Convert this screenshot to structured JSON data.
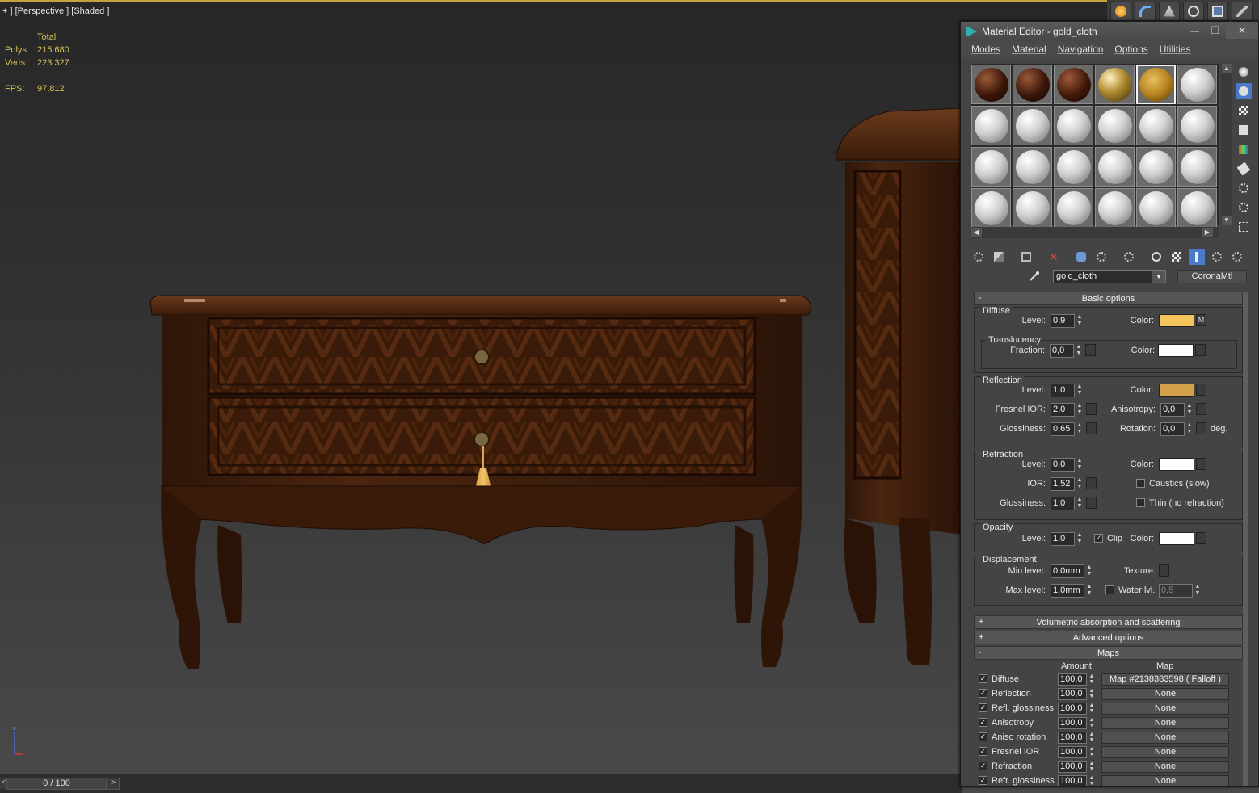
{
  "viewport": {
    "label": "+ ] [Perspective ] [Shaded ]",
    "stats": {
      "total_label": "Total",
      "polys_label": "Polys:",
      "polys_value": "215 680",
      "verts_label": "Verts:",
      "verts_value": "223 327",
      "fps_label": "FPS:",
      "fps_value": "97,812"
    },
    "stats_color": "#d9c45a"
  },
  "top_toolbar": {
    "icons": [
      "render-setup-icon",
      "render-frame-icon",
      "render-iterative-icon",
      "environment-icon",
      "render-window-icon",
      "hammer-icon"
    ]
  },
  "timeline": {
    "frame_label": "0 / 100",
    "prev": "<",
    "next": ">"
  },
  "material_editor": {
    "title": "Material Editor - gold_cloth",
    "window_buttons": {
      "minimize": "—",
      "maximize": "❐",
      "close": "✕"
    },
    "menu": [
      "Modes",
      "Material",
      "Navigation",
      "Options",
      "Utilities"
    ],
    "slots": {
      "row1": [
        "wood-dark",
        "wood-dark",
        "wood-dark",
        "gold-metal",
        "gold-cloth",
        "default"
      ],
      "active_index": 4
    },
    "name_field": "gold_cloth",
    "type_button": "CoronaMtl",
    "basic_options": {
      "header": "Basic options",
      "diffuse": {
        "title": "Diffuse",
        "level_label": "Level:",
        "level": "0,9",
        "color_label": "Color:",
        "color": "#f5c35c",
        "map_btn": "M",
        "translucency": {
          "title": "Translucency",
          "fraction_label": "Fraction:",
          "fraction": "0,0",
          "color_label": "Color:",
          "color": "#ffffff"
        }
      },
      "reflection": {
        "title": "Reflection",
        "level_label": "Level:",
        "level": "1,0",
        "color_label": "Color:",
        "color": "#d4a24a",
        "fresnel_label": "Fresnel IOR:",
        "fresnel": "2,0",
        "aniso_label": "Anisotropy:",
        "aniso": "0,0",
        "gloss_label": "Glossiness:",
        "gloss": "0,65",
        "rotation_label": "Rotation:",
        "rotation": "0,0",
        "deg": "deg."
      },
      "refraction": {
        "title": "Refraction",
        "level_label": "Level:",
        "level": "0,0",
        "color_label": "Color:",
        "color": "#ffffff",
        "ior_label": "IOR:",
        "ior": "1,52",
        "caustics": "Caustics (slow)",
        "gloss_label": "Glossiness:",
        "gloss": "1,0",
        "thin": "Thin (no refraction)"
      },
      "opacity": {
        "title": "Opacity",
        "level_label": "Level:",
        "level": "1,0",
        "clip": "Clip",
        "color_label": "Color:",
        "color": "#ffffff"
      },
      "displacement": {
        "title": "Displacement",
        "min_label": "Min level:",
        "min": "0,0mm",
        "texture_label": "Texture:",
        "max_label": "Max level:",
        "max": "1,0mm",
        "water_label": "Water lvl.",
        "water": "0,5"
      }
    },
    "rollouts": {
      "volumetric": "Volumetric absorption and scattering",
      "advanced": "Advanced options",
      "maps": "Maps"
    },
    "maps": {
      "amount_header": "Amount",
      "map_header": "Map",
      "rows": [
        {
          "name": "Diffuse",
          "amount": "100,0",
          "map": "Map #2138383598  ( Falloff )"
        },
        {
          "name": "Reflection",
          "amount": "100,0",
          "map": "None"
        },
        {
          "name": "Refl. glossiness",
          "amount": "100,0",
          "map": "None"
        },
        {
          "name": "Anisotropy",
          "amount": "100,0",
          "map": "None"
        },
        {
          "name": "Aniso rotation",
          "amount": "100,0",
          "map": "None"
        },
        {
          "name": "Fresnel IOR",
          "amount": "100,0",
          "map": "None"
        },
        {
          "name": "Refraction",
          "amount": "100,0",
          "map": "None"
        },
        {
          "name": "Refr. glossiness",
          "amount": "100,0",
          "map": "None"
        }
      ]
    }
  }
}
